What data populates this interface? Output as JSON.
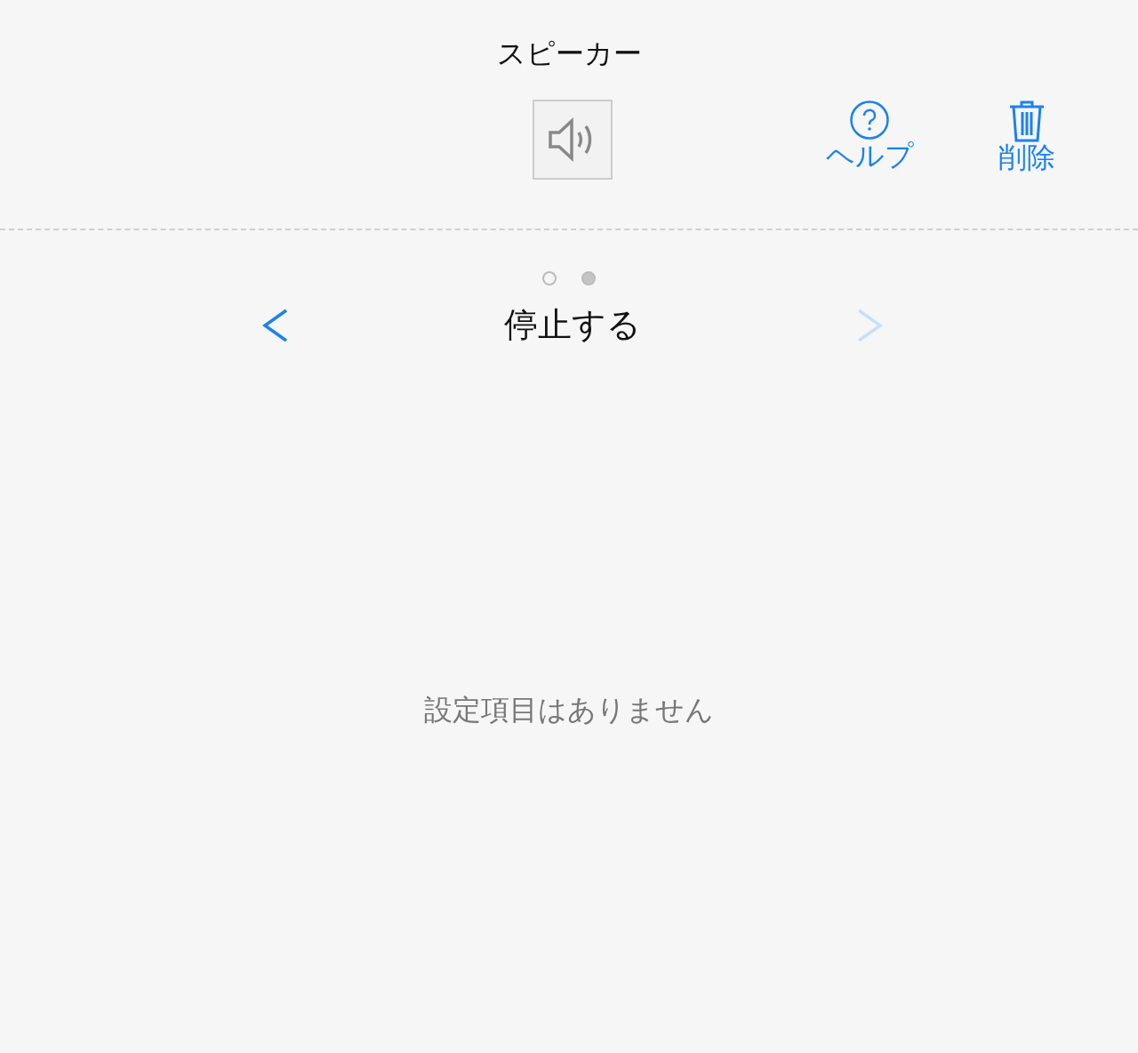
{
  "header": {
    "title": "スピーカー"
  },
  "toolbar": {
    "device_button": {
      "selected": false
    },
    "actions": [
      {
        "kind": "help",
        "label": "ヘルプ"
      },
      {
        "kind": "delete",
        "label": "削除"
      }
    ]
  },
  "pager": {
    "dots": [
      {
        "selected": false
      },
      {
        "selected": true
      }
    ],
    "prev": {
      "disabled": false
    },
    "next": {
      "disabled": true
    },
    "title": "停止する"
  },
  "empty_message": "設定項目はありません"
}
